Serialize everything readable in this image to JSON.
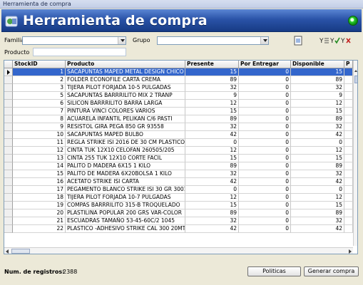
{
  "window": {
    "title": "Herramienta de compra"
  },
  "header": {
    "title": "Herramienta de compra"
  },
  "filters": {
    "familia_label": "Familia",
    "familia_value": "",
    "grupo_label": "Grupo",
    "grupo_value": "",
    "producto_label": "Producto",
    "producto_value": ""
  },
  "grid": {
    "columns": [
      "StockID",
      "Producto",
      "Presente",
      "Por Entregar",
      "Disponible",
      "P"
    ],
    "rows": [
      {
        "id": "1",
        "producto": "SACAPUNTAS MAPED METAL DESIGN CHICO",
        "presente": "15",
        "entregar": "0",
        "disponible": "15"
      },
      {
        "id": "2",
        "producto": "FOLDER ECONOFILE CARTA CREMA",
        "presente": "89",
        "entregar": "0",
        "disponible": "89"
      },
      {
        "id": "3",
        "producto": "TIJERA PILOT FORJADA 10-5 PULGADAS",
        "presente": "32",
        "entregar": "0",
        "disponible": "32"
      },
      {
        "id": "5",
        "producto": "SACAPUNTAS BARRRILITO MIX 2 TRANP",
        "presente": "9",
        "entregar": "0",
        "disponible": "9"
      },
      {
        "id": "6",
        "producto": "SILICON BARRRILITO BARRA LARGA",
        "presente": "12",
        "entregar": "0",
        "disponible": "12"
      },
      {
        "id": "7",
        "producto": "PINTURA VINCI COLORES VARIOS",
        "presente": "15",
        "entregar": "0",
        "disponible": "15"
      },
      {
        "id": "8",
        "producto": "ACUARELA INFANTIL PELIKAN C/6 PASTI",
        "presente": "89",
        "entregar": "0",
        "disponible": "89"
      },
      {
        "id": "9",
        "producto": "RESISTOL GIRA PEGA 850 GR 93558",
        "presente": "32",
        "entregar": "0",
        "disponible": "32"
      },
      {
        "id": "10",
        "producto": "SACAPUNTAS MAPED BULBO",
        "presente": "42",
        "entregar": "0",
        "disponible": "42"
      },
      {
        "id": "11",
        "producto": "REGLA STRIKE ISI 2016 DE 30 CM PLASTICO",
        "presente": "0",
        "entregar": "0",
        "disponible": "0"
      },
      {
        "id": "12",
        "producto": "CINTA TUK 12X10 CELOFAN 260505/205",
        "presente": "12",
        "entregar": "0",
        "disponible": "12"
      },
      {
        "id": "13",
        "producto": "CINTA 255 TUK 12X10 CORTE FACIL",
        "presente": "15",
        "entregar": "0",
        "disponible": "15"
      },
      {
        "id": "14",
        "producto": "PALITO D MADERA 6X15    1 KILO",
        "presente": "89",
        "entregar": "0",
        "disponible": "89"
      },
      {
        "id": "15",
        "producto": "PALITO DE MADERA 6X20BOLSA   1 KILO",
        "presente": "32",
        "entregar": "0",
        "disponible": "32"
      },
      {
        "id": "16",
        "producto": "ACETATO STRIKE ISI CARTA",
        "presente": "42",
        "entregar": "0",
        "disponible": "42"
      },
      {
        "id": "17",
        "producto": "PEGAMENTO BLANCO STRIKE ISI 30 GR 3001",
        "presente": "0",
        "entregar": "0",
        "disponible": "0"
      },
      {
        "id": "18",
        "producto": "TIJERA PILOT FORJADA 10-7 PULGADAS",
        "presente": "12",
        "entregar": "0",
        "disponible": "12"
      },
      {
        "id": "19",
        "producto": "COMPAS BARRRILITO 315-B TROQUELADO",
        "presente": "15",
        "entregar": "0",
        "disponible": "15"
      },
      {
        "id": "20",
        "producto": "PLASTILINA POPULAR 200 GRS VAR-COLOR",
        "presente": "89",
        "entregar": "0",
        "disponible": "89"
      },
      {
        "id": "21",
        "producto": "ESCUADRAS TAMAÑO 53-45-60C/2 1045",
        "presente": "32",
        "entregar": "0",
        "disponible": "32"
      },
      {
        "id": "22",
        "producto": "PLASTICO -ADHESIVO STRIKE CAL 300 20MTS",
        "presente": "42",
        "entregar": "0",
        "disponible": "42"
      }
    ],
    "selected_row": 0
  },
  "footer": {
    "count_label": "Num. de registros:",
    "count_value": "2388",
    "politicas_label": "Politicas",
    "generar_label": "Generar compra"
  },
  "icons": [
    "app-icon",
    "status-orb-icon",
    "document-icon",
    "filter-y-icon",
    "filter-y-check-icon",
    "filter-y-clear-icon"
  ],
  "colors": {
    "header_blue": "#2a53a8",
    "selection_blue": "#3366cc",
    "status_green": "#2fd02f"
  }
}
